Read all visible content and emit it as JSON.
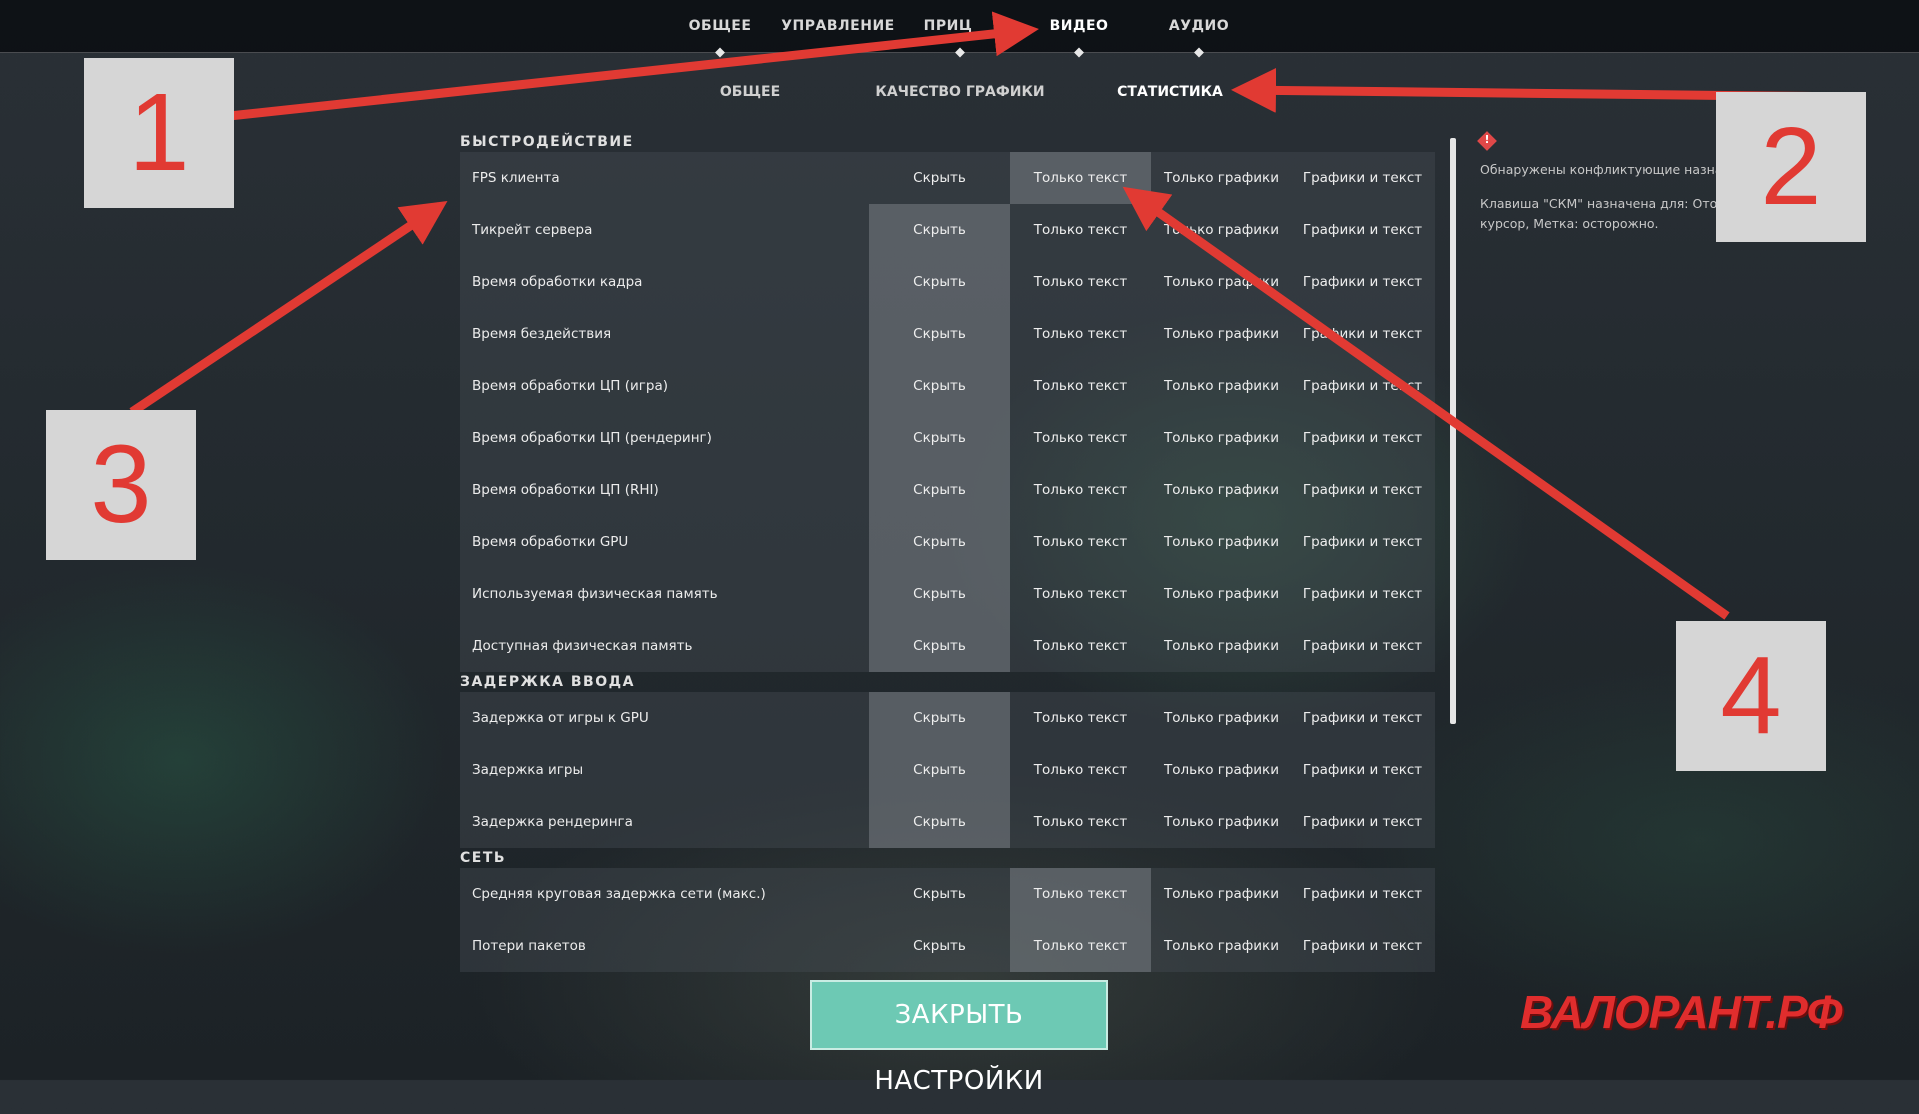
{
  "top_tabs": [
    {
      "label": "ОБЩЕЕ"
    },
    {
      "label": "УПРАВЛЕНИЕ"
    },
    {
      "label": "ПРИЦ"
    },
    {
      "label": "ВИДЕО"
    },
    {
      "label": "АУДИО"
    }
  ],
  "active_top_tab": "ВИДЕО",
  "sub_tabs": [
    {
      "label": "ОБЩЕЕ"
    },
    {
      "label": "КАЧЕСТВО ГРАФИКИ"
    },
    {
      "label": "СТАТИСТИКА"
    }
  ],
  "active_sub_tab": "СТАТИСТИКА",
  "option_labels": [
    "Скрыть",
    "Только текст",
    "Только графики",
    "Графики и текст"
  ],
  "sections": [
    {
      "title": "БЫСТРОДЕЙСТВИЕ",
      "rows": [
        {
          "label": "FPS клиента",
          "selected": "Только текст"
        },
        {
          "label": "Тикрейт сервера",
          "selected": "Скрыть"
        },
        {
          "label": "Время обработки кадра",
          "selected": "Скрыть"
        },
        {
          "label": "Время бездействия",
          "selected": "Скрыть"
        },
        {
          "label": "Время обработки ЦП (игра)",
          "selected": "Скрыть"
        },
        {
          "label": "Время обработки ЦП (рендеринг)",
          "selected": "Скрыть"
        },
        {
          "label": "Время обработки ЦП (RHI)",
          "selected": "Скрыть"
        },
        {
          "label": "Время обработки GPU",
          "selected": "Скрыть"
        },
        {
          "label": "Используемая физическая память",
          "selected": "Скрыть"
        },
        {
          "label": "Доступная физическая память",
          "selected": "Скрыть"
        }
      ]
    },
    {
      "title": "ЗАДЕРЖКА ВВОДА",
      "rows": [
        {
          "label": "Задержка от игры к GPU",
          "selected": "Скрыть"
        },
        {
          "label": "Задержка игры",
          "selected": "Скрыть"
        },
        {
          "label": "Задержка рендеринга",
          "selected": "Скрыть"
        }
      ]
    },
    {
      "title": "СЕТЬ",
      "rows": [
        {
          "label": "Средняя круговая задержка сети (макс.)",
          "selected": "Только текст"
        },
        {
          "label": "Потери пакетов",
          "selected": "Только текст"
        }
      ]
    }
  ],
  "conflict_notice": {
    "title": "Обнаружены конфликтующие назначения",
    "line1": "Клавиша \"СКМ\" назначена для: Отобразить",
    "line2": "курсор, Метка: осторожно.",
    "icon": "warning-diamond-icon",
    "icon_color": "#e04848"
  },
  "close_button": {
    "label": "ЗАКРЫТЬ НАСТРОЙКИ",
    "color": "#6dc9b4"
  },
  "annotations": [
    "1",
    "2",
    "3",
    "4"
  ],
  "annotation_color": "#e13a33",
  "watermark": "ВАЛОРАНТ.РФ"
}
